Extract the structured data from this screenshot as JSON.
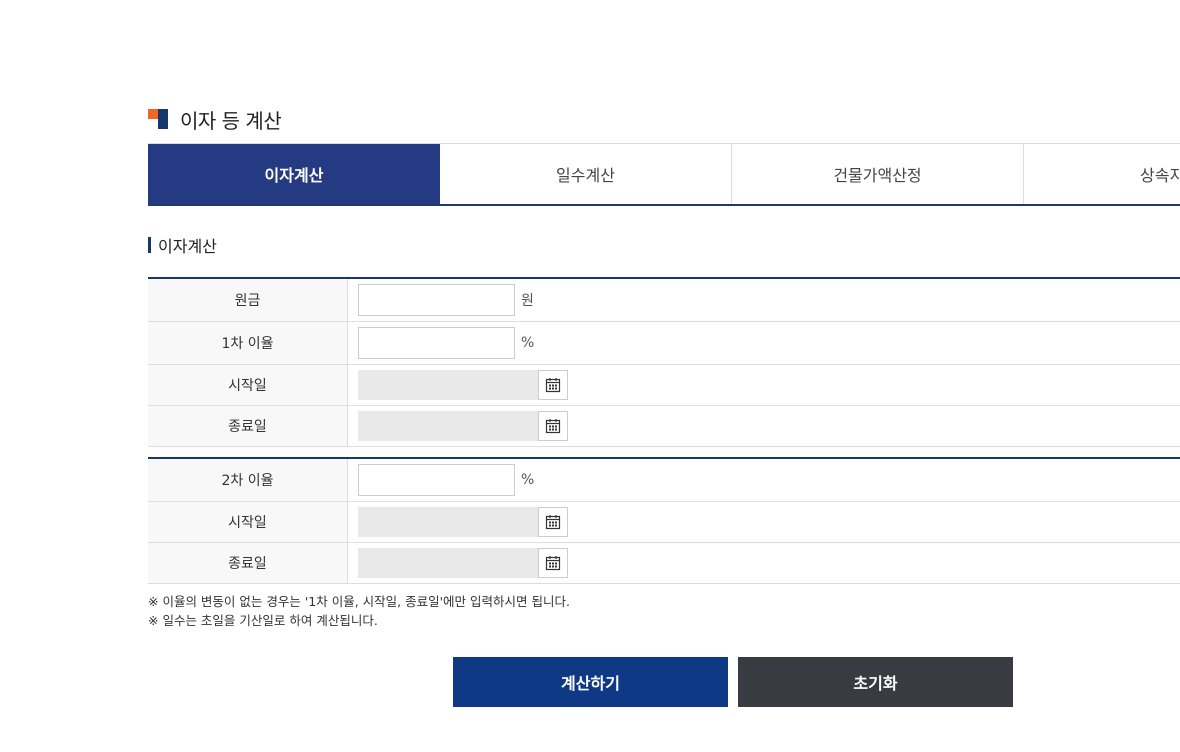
{
  "header": {
    "title": "이자 등 계산",
    "accent_orange": "#f26522",
    "accent_navy": "#16366e"
  },
  "tabs": [
    {
      "label": "이자계산",
      "active": true
    },
    {
      "label": "일수계산",
      "active": false
    },
    {
      "label": "건물가액산정",
      "active": false
    },
    {
      "label": "상속지분",
      "active": false
    }
  ],
  "section": {
    "title": "이자계산"
  },
  "form1": {
    "principal_label": "원금",
    "principal_value": "",
    "principal_unit": "원",
    "rate1_label": "1차 이율",
    "rate1_value": "",
    "rate1_unit": "%",
    "start1_label": "시작일",
    "start1_value": "",
    "end1_label": "종료일",
    "end1_value": ""
  },
  "form2": {
    "rate2_label": "2차 이율",
    "rate2_value": "",
    "rate2_unit": "%",
    "start2_label": "시작일",
    "start2_value": "",
    "end2_label": "종료일",
    "end2_value": ""
  },
  "notes": [
    "※ 이율의 변동이 없는 경우는 '1차 이율, 시작일, 종료일'에만 입력하시면 됩니다.",
    "※ 일수는 초일을 기산일로 하여 계산됩니다."
  ],
  "buttons": {
    "calculate_label": "계산하기",
    "calculate_color": "#0f3885",
    "reset_label": "초기화",
    "reset_color": "#383b42"
  },
  "icons": {
    "calendar": "calendar-icon"
  }
}
